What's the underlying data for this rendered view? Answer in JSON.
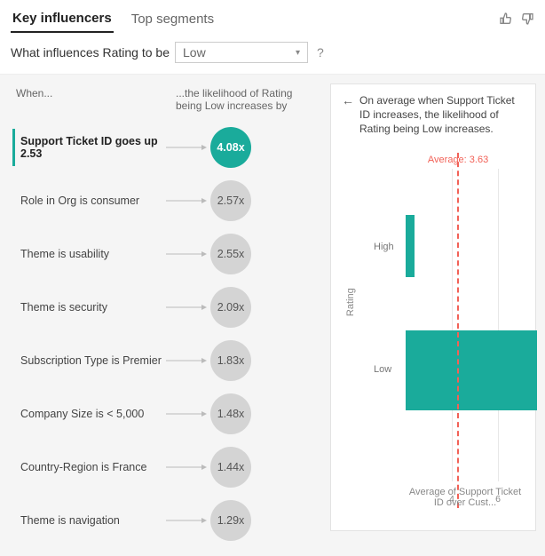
{
  "tabs": {
    "key_influencers": "Key influencers",
    "top_segments": "Top segments"
  },
  "question": {
    "prefix": "What influences Rating to be",
    "dropdown_value": "Low",
    "help": "?"
  },
  "headers": {
    "when": "When...",
    "likelihood": "...the likelihood of Rating being Low increases by"
  },
  "influencers": [
    {
      "label": "Support Ticket ID goes up 2.53",
      "value": "4.08x",
      "selected": true
    },
    {
      "label": "Role in Org is consumer",
      "value": "2.57x",
      "selected": false
    },
    {
      "label": "Theme is usability",
      "value": "2.55x",
      "selected": false
    },
    {
      "label": "Theme is security",
      "value": "2.09x",
      "selected": false
    },
    {
      "label": "Subscription Type is Premier",
      "value": "1.83x",
      "selected": false
    },
    {
      "label": "Company Size is < 5,000",
      "value": "1.48x",
      "selected": false
    },
    {
      "label": "Country-Region is France",
      "value": "1.44x",
      "selected": false
    },
    {
      "label": "Theme is navigation",
      "value": "1.29x",
      "selected": false
    }
  ],
  "detail": {
    "title": "On average when Support Ticket ID increases, the likelihood of Rating being Low increases.",
    "avg_label": "Average: 3.63",
    "xaxis_title": "Average of Support Ticket ID over Cust...",
    "yaxis_title": "Rating",
    "ylabels": {
      "high": "High",
      "low": "Low"
    },
    "xticks": {
      "t4": "4",
      "t6": "6"
    }
  },
  "chart_data": {
    "type": "bar",
    "orientation": "horizontal",
    "title": "On average when Support Ticket ID increases, the likelihood of Rating being Low increases.",
    "xlabel": "Average of Support Ticket ID over Cust...",
    "ylabel": "Rating",
    "categories": [
      "High",
      "Low"
    ],
    "values": [
      2.3,
      6.2
    ],
    "reference_line": {
      "label": "Average",
      "value": 3.63
    },
    "xlim": [
      2,
      7
    ],
    "xticks": [
      4,
      6
    ]
  }
}
